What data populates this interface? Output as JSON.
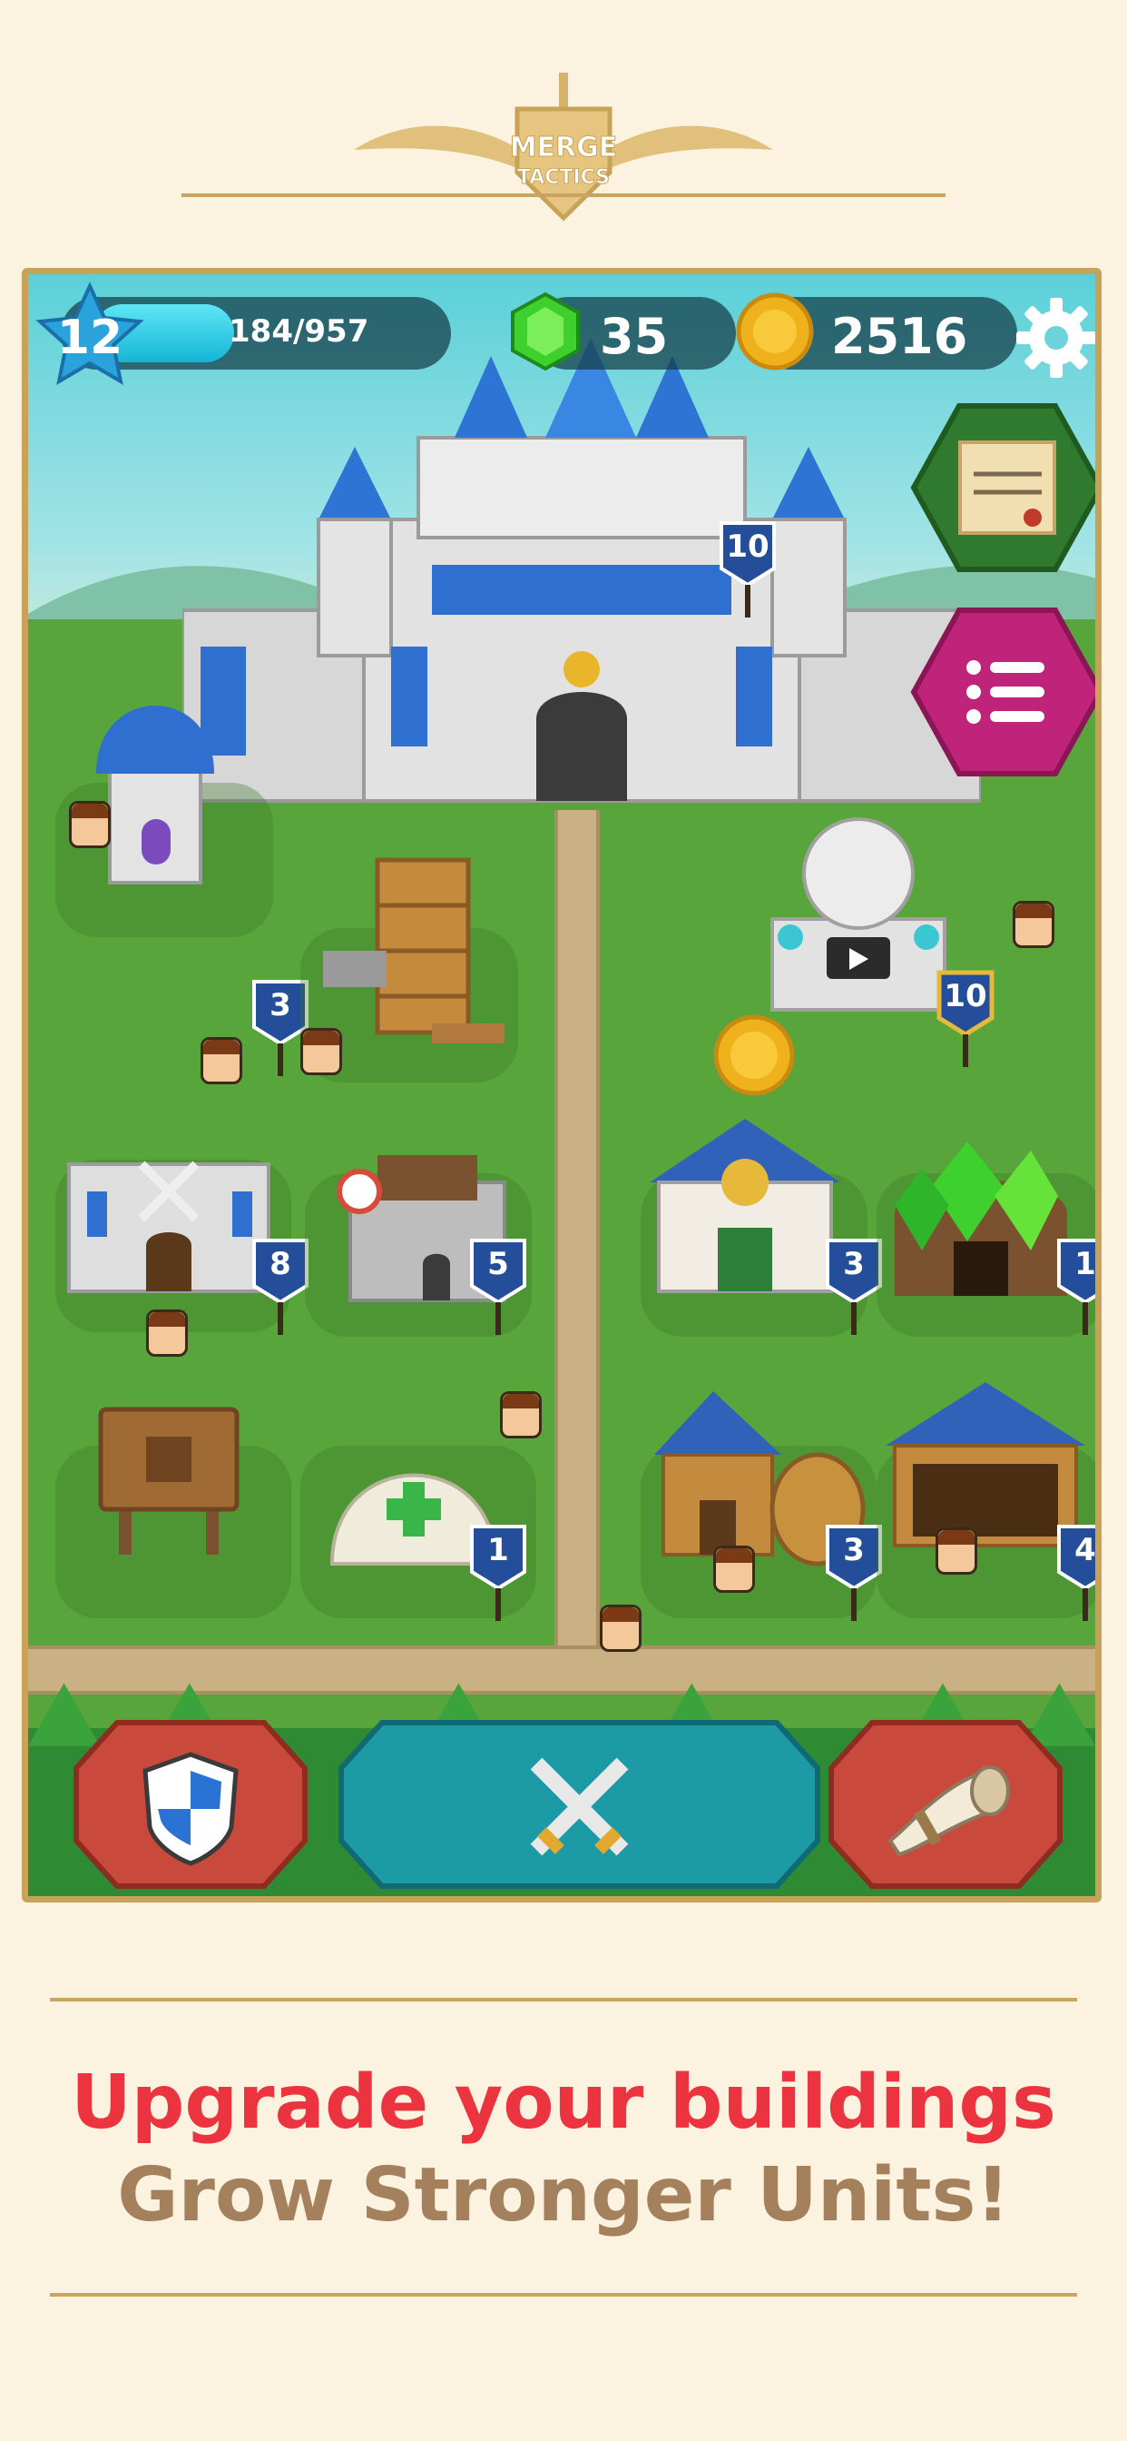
{
  "brand": {
    "logo_text": "MERGE TACTICS"
  },
  "hud": {
    "level": "12",
    "xp_text": "184/957",
    "xp_progress": 0.19,
    "gems": "35",
    "coins": "2516"
  },
  "castle": {
    "level": "10"
  },
  "statue": {
    "level": "10"
  },
  "buildings": [
    {
      "name": "wizard-tower",
      "level": "3"
    },
    {
      "name": "workshop",
      "level": ""
    },
    {
      "name": "barracks",
      "level": "8"
    },
    {
      "name": "archery-range",
      "level": "5"
    },
    {
      "name": "town-hall",
      "level": "3"
    },
    {
      "name": "gem-mine",
      "level": "1"
    },
    {
      "name": "storage-sign",
      "level": ""
    },
    {
      "name": "hospital-tent",
      "level": "1"
    },
    {
      "name": "tavern",
      "level": "3"
    },
    {
      "name": "stable",
      "level": "4"
    }
  ],
  "colors": {
    "accent_red": "#ec3441",
    "accent_brown": "#a4805c",
    "frame_gold": "#c9a25a",
    "battle_teal": "#1c9aa6",
    "side_red": "#c94a3d",
    "menu_magenta": "#c0237a"
  },
  "icons": [
    "star-icon",
    "gem-icon",
    "coin-icon",
    "gear-icon",
    "scroll-icon",
    "menu-icon",
    "shield-icon",
    "crossed-swords-icon",
    "horn-icon"
  ],
  "caption": {
    "headline": "Upgrade your buildings",
    "subline": "Grow Stronger Units!"
  }
}
